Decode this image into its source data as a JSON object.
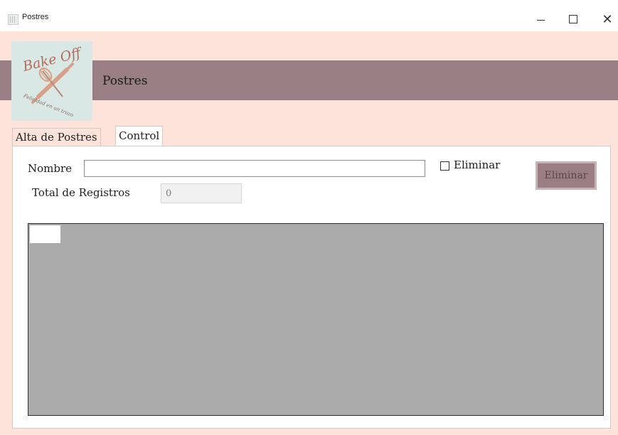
{
  "window": {
    "title": "Postres"
  },
  "header": {
    "logo": {
      "text": "Bake Off",
      "tagline": "Felicidad en un trozo",
      "icon": "whisk-rolling-pin-icon"
    },
    "title": "Postres",
    "banner_color": "#997f83"
  },
  "tabs": [
    {
      "label": "Alta de Postres",
      "selected": false
    },
    {
      "label": "Control",
      "selected": true
    }
  ],
  "form": {
    "nombre_label": "Nombre",
    "nombre_value": "",
    "total_label": "Total de Registros",
    "total_value": "0",
    "eliminar_checkbox_label": "Eliminar",
    "eliminar_checked": false,
    "eliminar_button_label": "Eliminar"
  },
  "grid": {
    "rows": [],
    "background": "#ababab"
  }
}
